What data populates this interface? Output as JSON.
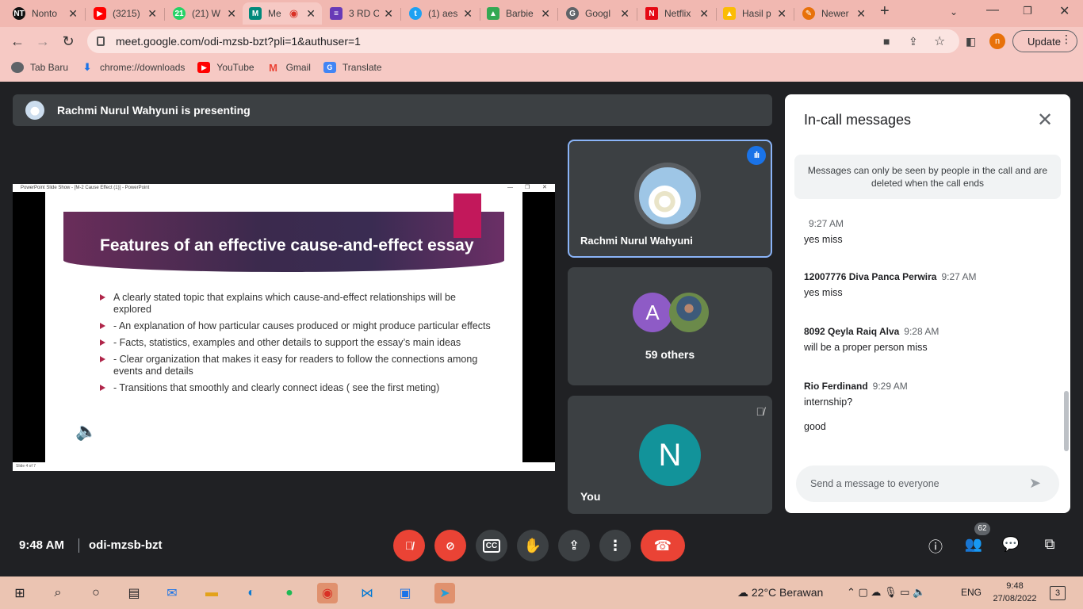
{
  "browser": {
    "tabs": [
      {
        "title": "Nonto",
        "fav": "NT",
        "color": "#c62828"
      },
      {
        "title": "(3215)",
        "fav": "▶",
        "color": "#ff0000"
      },
      {
        "title": "(21) W",
        "fav": "21",
        "color": "#25d366"
      },
      {
        "title": "Me",
        "fav": "M",
        "color": "#00897b"
      },
      {
        "title": "3 RD C",
        "fav": "≡",
        "color": "#673ab7"
      },
      {
        "title": "(1) aes",
        "fav": "t",
        "color": "#1da1f2"
      },
      {
        "title": "Barbie",
        "fav": "▲",
        "color": "#34a853"
      },
      {
        "title": "Googl",
        "fav": "G",
        "color": "#5f6368"
      },
      {
        "title": "Netflix",
        "fav": "N",
        "color": "#e50914"
      },
      {
        "title": "Hasil p",
        "fav": "▲",
        "color": "#fbbc04"
      },
      {
        "title": "Newer",
        "fav": "✎",
        "color": "#e8710a"
      }
    ],
    "url": "meet.google.com/odi-mzsb-bzt?pli=1&authuser=1",
    "profile_initial": "n",
    "update_label": "Update",
    "bookmarks": [
      {
        "label": "Tab Baru",
        "icon": "globe-icon"
      },
      {
        "label": "chrome://downloads",
        "icon": "download-icon"
      },
      {
        "label": "YouTube",
        "icon": "youtube-icon"
      },
      {
        "label": "Gmail",
        "icon": "gmail-icon"
      },
      {
        "label": "Translate",
        "icon": "translate-icon"
      }
    ]
  },
  "meet": {
    "presenting_banner": "Rachmi Nurul Wahyuni is presenting",
    "slide": {
      "window_title": "PowerPoint Slide Show - [M-2 Cause Effect (1)] - PowerPoint",
      "title": "Features of an effective cause-and-effect essay",
      "bullets": [
        "A clearly stated topic that explains which cause-and-effect relationships will be explored",
        "- An explanation of how particular causes produced or might produce particular effects",
        "- Facts, statistics, examples and other details to support the essay’s main ideas",
        "- Clear organization that makes it easy for readers to follow the connections among events and details",
        "- Transitions that smoothly and clearly connect ideas ( see the first meting)"
      ],
      "status": "Slide 4 of 7"
    },
    "tiles": {
      "presenter_name": "Rachmi Nurul Wahyuni",
      "others_initial": "A",
      "others_label": "59 others",
      "you_initial": "N",
      "you_label": "You"
    },
    "chat": {
      "title": "In-call messages",
      "notice": "Messages can only be seen by people in the call and are deleted when the call ends",
      "messages": [
        {
          "sender": "",
          "time": "9:27 AM",
          "text": "yes miss"
        },
        {
          "sender": "12007776 Diva Panca Perwira",
          "time": "9:27 AM",
          "text": "yes miss"
        },
        {
          "sender": "8092 Qeyla Raiq Alva",
          "time": "9:28 AM",
          "text": "will be a proper person miss"
        },
        {
          "sender": "Rio Ferdinand",
          "time": "9:29 AM",
          "text": "internship?"
        },
        {
          "sender": "",
          "time": "",
          "text": "good"
        }
      ],
      "input_placeholder": "Send a message to everyone"
    },
    "clock": "9:48 AM",
    "meeting_code": "odi-mzsb-bzt",
    "people_count": "62"
  },
  "taskbar": {
    "weather": "22°C  Berawan",
    "language": "ENG",
    "time": "9:48",
    "date": "27/08/2022",
    "notifications": "3"
  }
}
